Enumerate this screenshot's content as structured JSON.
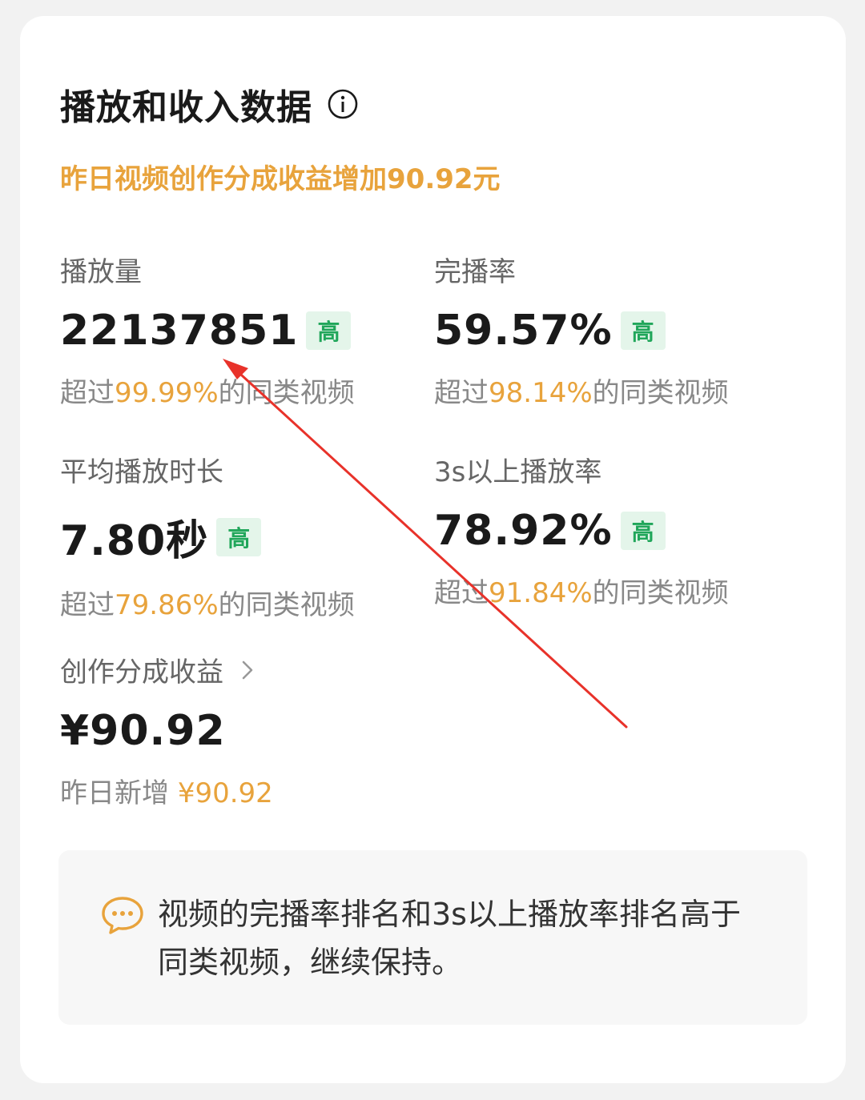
{
  "header": {
    "title": "播放和收入数据",
    "info_icon": "info-circle-icon",
    "subtitle": "昨日视频创作分成收益增加90.92元"
  },
  "metrics": {
    "plays": {
      "label": "播放量",
      "value": "22137851",
      "badge": "高",
      "compare_prefix": "超过",
      "compare_pct": "99.99%",
      "compare_suffix": "的同类视频"
    },
    "completion": {
      "label": "完播率",
      "value": "59.57%",
      "badge": "高",
      "compare_prefix": "超过",
      "compare_pct": "98.14%",
      "compare_suffix": "的同类视频"
    },
    "avg_duration": {
      "label": "平均播放时长",
      "value": "7.80秒",
      "badge": "高",
      "compare_prefix": "超过",
      "compare_pct": "79.86%",
      "compare_suffix": "的同类视频"
    },
    "play_3s": {
      "label": "3s以上播放率",
      "value": "78.92%",
      "badge": "高",
      "compare_prefix": "超过",
      "compare_pct": "91.84%",
      "compare_suffix": "的同类视频"
    }
  },
  "revenue": {
    "label": "创作分成收益",
    "chevron_icon": "chevron-right-icon",
    "value": "¥90.92",
    "new_label": "昨日新增",
    "new_value": "¥90.92"
  },
  "tip": {
    "icon": "chat-bubble-icon",
    "text": "视频的完播率排名和3s以上播放率排名高于同类视频，继续保持。"
  },
  "colors": {
    "accent_orange": "#e8a33c",
    "badge_green": "#20a65a",
    "badge_bg": "#e4f5ea",
    "annotation_red": "#e8322a"
  }
}
